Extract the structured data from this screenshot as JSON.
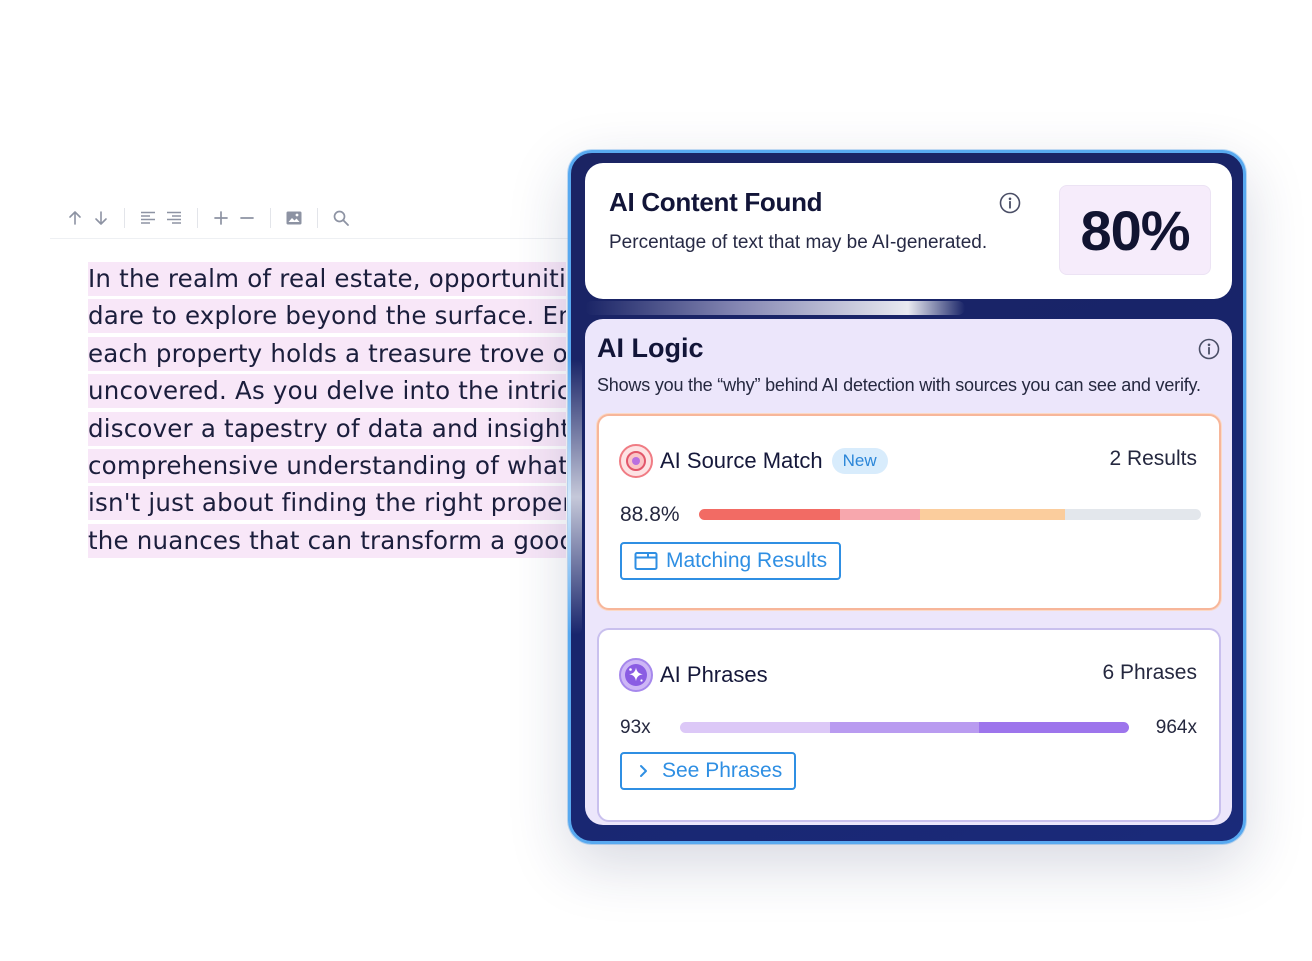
{
  "editor": {
    "lines": [
      "In the realm of real estate, opportunities",
      "dare to explore beyond the surface. Em",
      "each property holds a treasure trove of",
      "uncovered. As you delve into the intrica",
      "discover a tapestry of data and insights",
      "comprehensive understanding of what",
      "isn't just about finding the right propert",
      "the nuances that can transform a good"
    ]
  },
  "ai_content": {
    "title": "AI Content Found",
    "subtitle": "Percentage of text that may be AI-generated.",
    "percentage": "80%"
  },
  "ai_logic": {
    "title": "AI Logic",
    "subtitle": "Shows you the “why” behind AI detection with sources you can see and verify.",
    "source_match": {
      "name": "AI Source Match",
      "badge": "New",
      "count": "2 Results",
      "score": "88.8%",
      "bar_fill": 0.73,
      "button": "Matching Results",
      "colors": [
        "#f26b64",
        "#f7a7ad",
        "#fbcd9d",
        "#e3e7ec"
      ]
    },
    "phrases": {
      "name": "AI Phrases",
      "count": "6 Phrases",
      "min_label": "93x",
      "max_label": "964x",
      "button": "See Phrases",
      "colors": [
        "#dcc8f7",
        "#b99bf0",
        "#9d75ec"
      ]
    }
  }
}
